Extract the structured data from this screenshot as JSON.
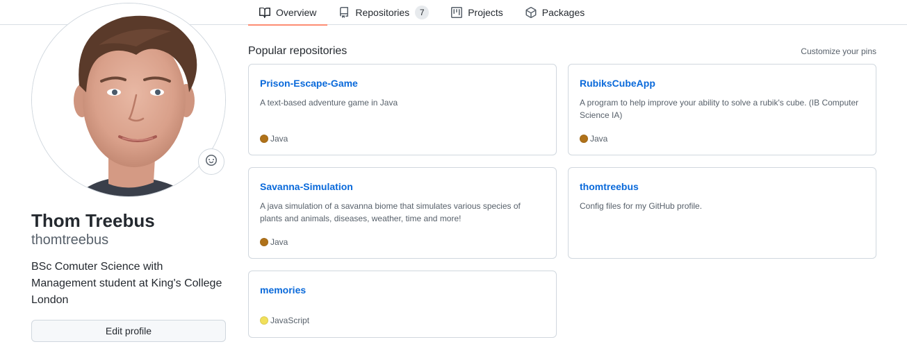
{
  "nav": {
    "tabs": [
      {
        "label": "Overview",
        "icon": "book-icon",
        "selected": true
      },
      {
        "label": "Repositories",
        "icon": "repo-icon",
        "count": "7"
      },
      {
        "label": "Projects",
        "icon": "project-icon"
      },
      {
        "label": "Packages",
        "icon": "package-icon"
      }
    ]
  },
  "profile": {
    "full_name": "Thom Treebus",
    "username": "thomtreebus",
    "bio": "BSc Comuter Science with Management student at King's College London",
    "edit_label": "Edit profile",
    "status_icon": "smiley-icon"
  },
  "popular": {
    "title": "Popular repositories",
    "customize_label": "Customize your pins",
    "repos": [
      {
        "name": "Prison-Escape-Game",
        "description": "A text-based adventure game in Java",
        "language": "Java",
        "language_color": "#b07219"
      },
      {
        "name": "RubiksCubeApp",
        "description": "A program to help improve your ability to solve a rubik's cube. (IB Computer Science IA)",
        "language": "Java",
        "language_color": "#b07219"
      },
      {
        "name": "Savanna-Simulation",
        "description": "A java simulation of a savanna biome that simulates various species of plants and animals, diseases, weather, time and more!",
        "language": "Java",
        "language_color": "#b07219"
      },
      {
        "name": "thomtreebus",
        "description": "Config files for my GitHub profile.",
        "language": "",
        "language_color": ""
      },
      {
        "name": "memories",
        "description": "",
        "language": "JavaScript",
        "language_color": "#f1e05a"
      }
    ]
  },
  "colors": {
    "link": "#0969da",
    "tab_underline": "#fd8c73",
    "border": "#d0d7de"
  }
}
